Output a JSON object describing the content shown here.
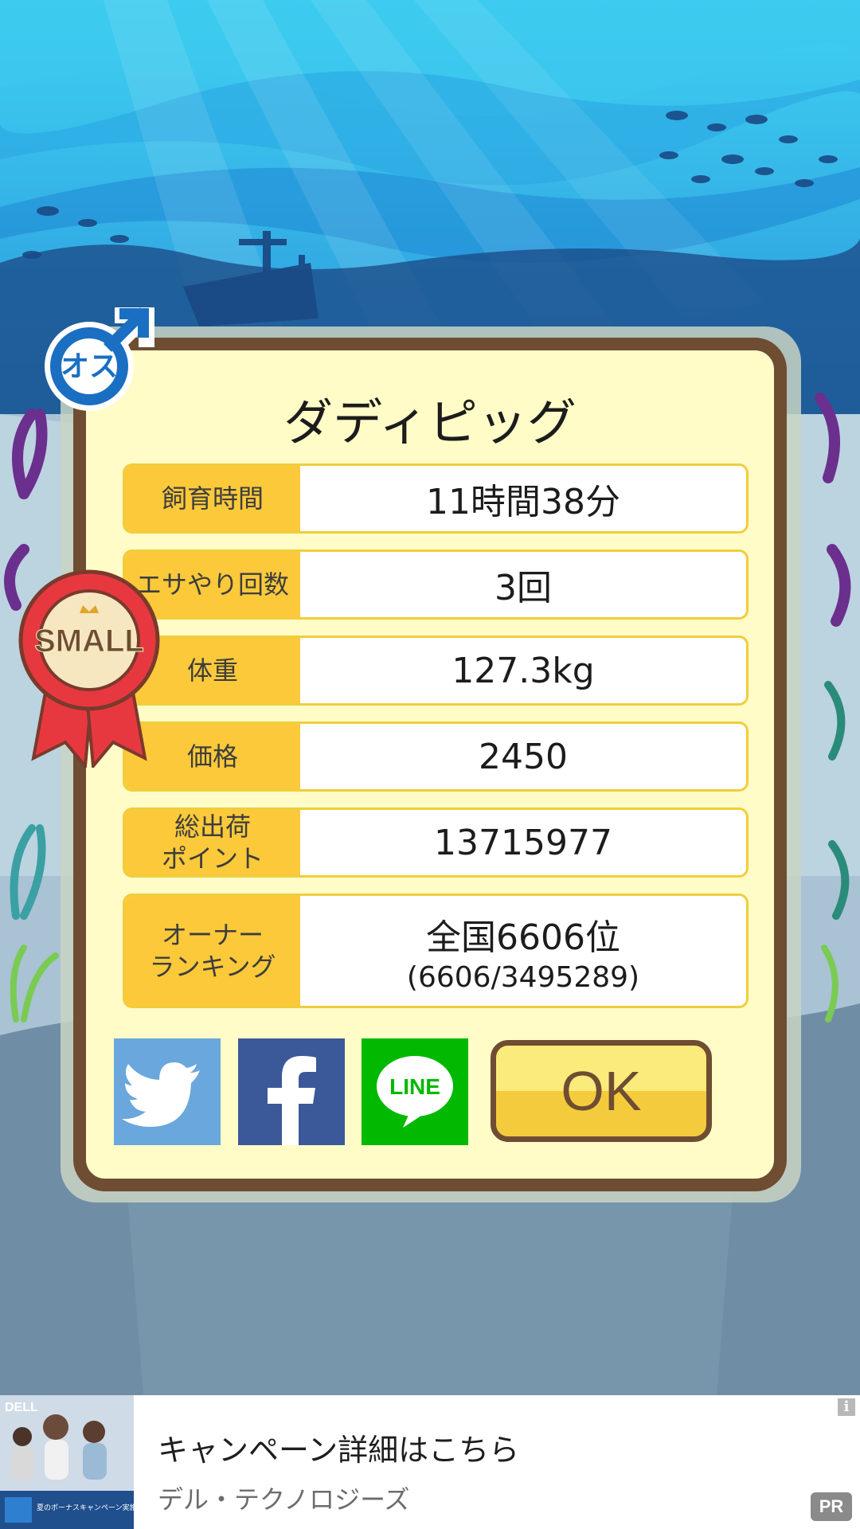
{
  "pig": {
    "name": "ダディピッグ",
    "gender_badge": "オス",
    "size_ribbon": "SMALL"
  },
  "stats": [
    {
      "label": "飼育時間",
      "value": "11時間38分"
    },
    {
      "label": "エサやり回数",
      "value": "3回"
    },
    {
      "label": "体重",
      "value": "127.3kg"
    },
    {
      "label": "価格",
      "value": "2450"
    },
    {
      "label": "総出荷\nポイント",
      "value": "13715977"
    },
    {
      "label": "オーナー\nランキング",
      "value": "全国6606位",
      "sub_value": "(6606/3495289)"
    }
  ],
  "share": {
    "twitter_icon": "twitter-bird-icon",
    "facebook_icon": "facebook-f-icon",
    "line_label": "LINE"
  },
  "ok_label": "OK",
  "ad": {
    "title": "キャンペーン詳細はこちら",
    "advertiser": "デル・テクノロジーズ",
    "pr_label": "PR",
    "info_icon": "i",
    "image_brand": "DELL",
    "image_caption": "夏のボーナスキャンペーン実施中"
  },
  "colors": {
    "card_bg": "#fffcc8",
    "card_border": "#6e4d33",
    "label_bg": "#fbc93a",
    "twitter": "#6aa7dc",
    "facebook": "#3b5998",
    "line": "#00b900",
    "ribbon": "#e8383f",
    "gender_blue": "#1a6fc2"
  }
}
